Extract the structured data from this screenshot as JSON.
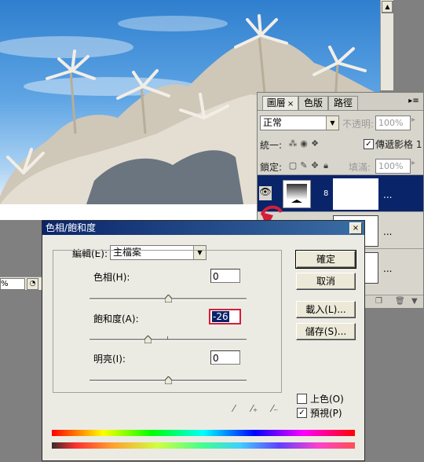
{
  "statusbar": {
    "zoom": "%"
  },
  "layers_panel": {
    "tabs": [
      {
        "label": "圖層",
        "close": "×"
      },
      {
        "label": "色版"
      },
      {
        "label": "路徑"
      }
    ],
    "blend_mode": "正常",
    "opacity_label": "不透明:",
    "opacity_value": "100%",
    "unify_label": "統一:",
    "propagate_label": "傳遞影格 1",
    "lock_label": "鎖定:",
    "fill_label": "填滿:",
    "fill_value": "100%",
    "layer_name_placeholder": "..."
  },
  "dialog": {
    "title": "色相/飽和度",
    "close": "×",
    "edit_label": "編輯(E):",
    "edit_value": "主檔案",
    "hue_label": "色相(H):",
    "hue_value": "0",
    "saturation_label": "飽和度(A):",
    "saturation_value": "-26",
    "lightness_label": "明亮(I):",
    "lightness_value": "0",
    "sliders": {
      "hue_level": 0.5,
      "saturation_level": 0.37,
      "lightness_level": 0.5
    },
    "ok": "確定",
    "cancel": "取消",
    "load": "載入(L)...",
    "save": "儲存(S)...",
    "colorize_label": "上色(O)",
    "colorize_checked": false,
    "preview_label": "預視(P)",
    "preview_checked": true
  },
  "colors": {
    "selection_blue": "#0a246a",
    "highlight_red": "#d41e3a",
    "dialog_bg": "#ecebe3"
  }
}
